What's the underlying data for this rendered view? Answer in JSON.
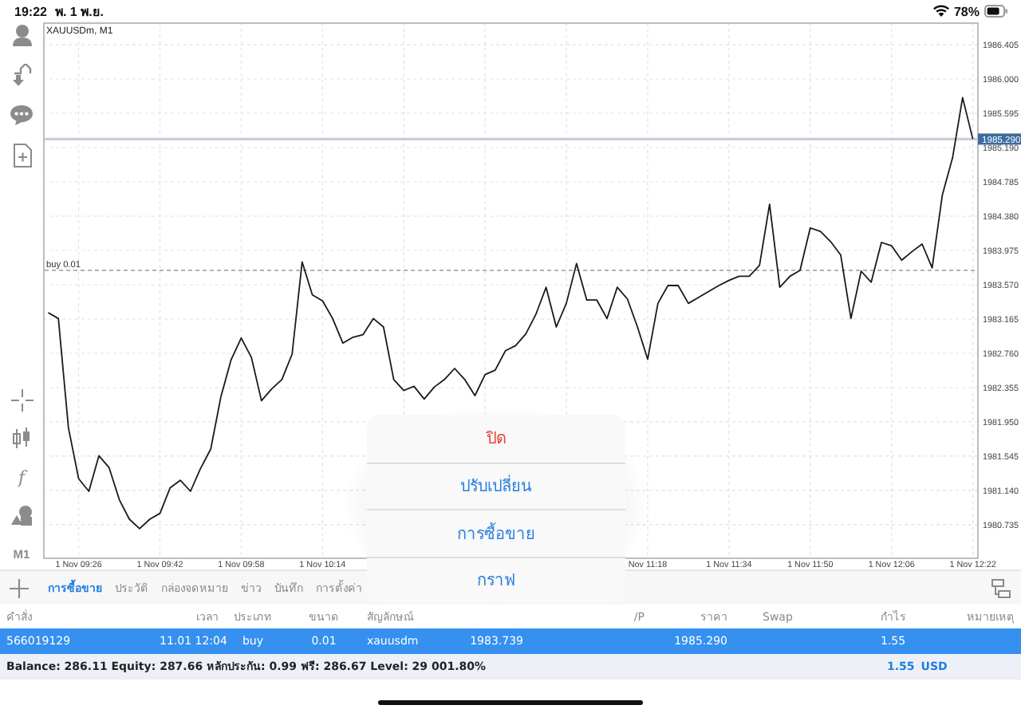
{
  "status_bar": {
    "time": "19:22",
    "date": "พ. 1 พ.ย.",
    "battery": "78%"
  },
  "rail": {
    "function_glyph": "f",
    "timeframe": "M1"
  },
  "chart": {
    "chart_data": {
      "type": "line",
      "title": "XAUUSDm, M1",
      "categories": [
        null,
        null,
        null,
        "1 Nov 09:26",
        null,
        null,
        null,
        null,
        null,
        null,
        null,
        "1 Nov 09:42",
        null,
        null,
        null,
        null,
        null,
        null,
        null,
        "1 Nov 09:58",
        null,
        null,
        null,
        null,
        null,
        null,
        null,
        "1 Nov 10:14",
        null,
        null,
        null,
        null,
        null,
        null,
        null,
        null,
        null,
        null,
        null,
        null,
        null,
        null,
        null,
        null,
        null,
        null,
        null,
        null,
        null,
        null,
        null,
        null,
        null,
        null,
        null,
        null,
        null,
        null,
        null,
        "Nov 11:18",
        null,
        null,
        null,
        null,
        null,
        null,
        null,
        "1 Nov 11:34",
        null,
        null,
        null,
        null,
        null,
        null,
        null,
        "1 Nov 11:50",
        null,
        null,
        null,
        null,
        null,
        null,
        null,
        "1 Nov 12:06",
        null,
        null,
        null,
        null,
        null,
        null,
        null,
        "1 Nov 12:22"
      ],
      "series": [
        {
          "color": "#1a1a1a",
          "values": [
            1983.24,
            1983.17,
            1981.88,
            1981.28,
            1981.13,
            1981.55,
            1981.41,
            1981.03,
            1980.8,
            1980.69,
            1980.8,
            1980.87,
            1981.17,
            1981.26,
            1981.13,
            1981.4,
            1981.63,
            1982.25,
            1982.68,
            1982.94,
            1982.71,
            1982.2,
            1982.34,
            1982.45,
            1982.75,
            1983.84,
            1983.45,
            1983.38,
            1983.17,
            1982.88,
            1982.95,
            1982.98,
            1983.17,
            1983.07,
            1982.45,
            1982.32,
            1982.37,
            1982.22,
            1982.36,
            1982.45,
            1982.58,
            1982.45,
            1982.26,
            1982.51,
            1982.56,
            1982.79,
            1982.85,
            1982.99,
            1983.22,
            1983.54,
            1983.07,
            1983.35,
            1983.82,
            1983.39,
            1983.39,
            1983.17,
            1983.54,
            1983.4,
            1983.07,
            1982.69,
            1983.35,
            1983.56,
            1983.56,
            1983.35,
            1983.42,
            1983.49,
            1983.56,
            1983.62,
            1983.67,
            1983.67,
            1983.8,
            1984.52,
            1983.54,
            1983.67,
            1983.74,
            1984.24,
            1984.2,
            1984.08,
            1983.92,
            1983.17,
            1983.73,
            1983.6,
            1984.07,
            1984.03,
            1983.86,
            1983.96,
            1984.05,
            1983.77,
            1984.63,
            1985.07,
            1985.78,
            1985.29
          ]
        }
      ],
      "ylim": [
        1980.339,
        1986.669
      ],
      "grid": true,
      "yticks": [
        {
          "value": 1986.405,
          "label": "1986.405"
        },
        {
          "value": 1986.0,
          "label": "1986.000"
        },
        {
          "value": 1985.595,
          "label": "1985.595"
        },
        {
          "value": 1985.19,
          "label": "1985.190"
        },
        {
          "value": 1984.785,
          "label": "1984.785"
        },
        {
          "value": 1984.38,
          "label": "1984.380"
        },
        {
          "value": 1983.975,
          "label": "1983.975"
        },
        {
          "value": 1983.57,
          "label": "1983.570"
        },
        {
          "value": 1983.165,
          "label": "1983.165"
        },
        {
          "value": 1982.76,
          "label": "1982.760"
        },
        {
          "value": 1982.355,
          "label": "1982.355"
        },
        {
          "value": 1981.95,
          "label": "1981.950"
        },
        {
          "value": 1981.545,
          "label": "1981.545"
        },
        {
          "value": 1981.14,
          "label": "1981.140"
        },
        {
          "value": 1980.735,
          "label": "1980.735"
        }
      ],
      "ref_lines": [
        {
          "axis": "y",
          "value": 1985.29,
          "label": "1985.290",
          "color": "#c7ced8"
        },
        {
          "axis": "y",
          "value": 1983.739,
          "label": "buy 0.01",
          "color": "#9a9a9a"
        }
      ]
    }
  },
  "menu": {
    "items": [
      {
        "label": "ปิด",
        "kind": "destructive"
      },
      {
        "label": "ปรับเปลี่ยน",
        "kind": "action"
      },
      {
        "label": "การซื้อขาย",
        "kind": "action"
      },
      {
        "label": "กราฟ",
        "kind": "action"
      }
    ]
  },
  "terminal": {
    "tabs": [
      {
        "label": "การซื้อขาย",
        "selected": true
      },
      {
        "label": "ประวัติ",
        "selected": false
      },
      {
        "label": "กล่องจดหมาย",
        "selected": false
      },
      {
        "label": "ข่าว",
        "selected": false
      },
      {
        "label": "บันทึก",
        "selected": false
      },
      {
        "label": "การตั้งค่า",
        "selected": false
      }
    ],
    "columns": [
      {
        "header": "คำสั่ง"
      },
      {
        "header": "เวลา"
      },
      {
        "header": "ประเภท"
      },
      {
        "header": "ขนาด"
      },
      {
        "header": "สัญลักษณ์"
      },
      {},
      {},
      {
        "header": "/P"
      },
      {
        "header": "ราคา"
      },
      {
        "header": "Swap"
      },
      {
        "header": "กำไร"
      },
      {
        "header": "หมายเหตุ"
      }
    ],
    "rows": [
      {
        "selected": true,
        "cells": [
          "566019129",
          "11.01 12:04",
          "buy",
          "0.01",
          "xauusdm",
          "1983.739",
          null,
          null,
          "1985.290",
          null,
          "1.55",
          null
        ]
      }
    ],
    "summary": {
      "text": "Balance: 286.11 Equity: 287.66 หลักประกัน: 0.99 ฟรี: 286.67 Level: 29 001.80%",
      "total": "1.55",
      "currency": "USD"
    }
  }
}
